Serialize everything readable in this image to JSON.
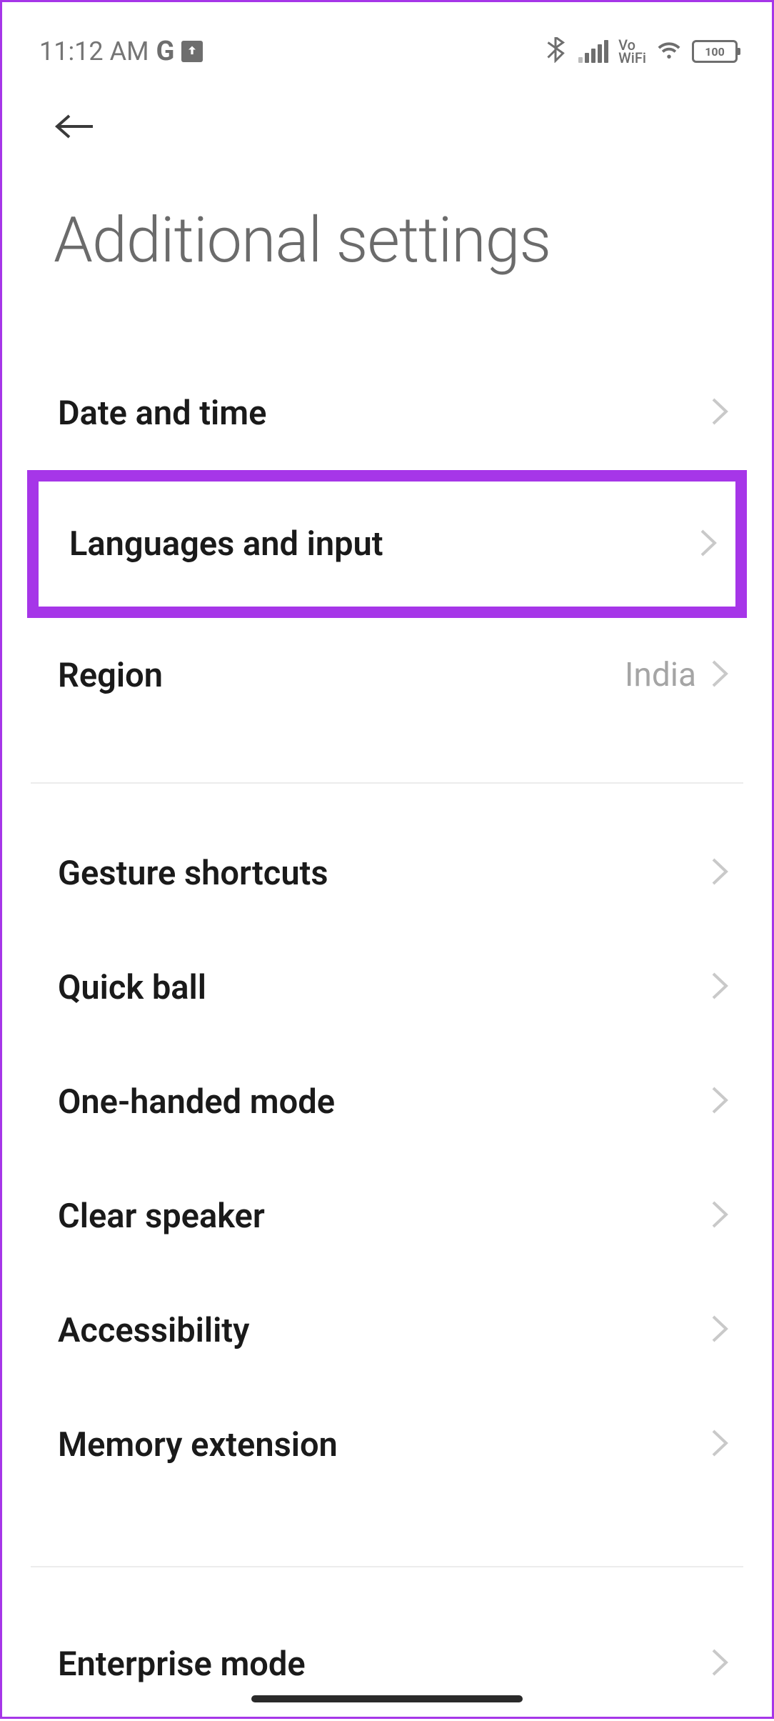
{
  "status_bar": {
    "time": "11:12 AM",
    "vowifi_top": "Vo",
    "vowifi_bottom": "WiFi",
    "battery": "100"
  },
  "page_title": "Additional settings",
  "items": {
    "date_time": "Date and time",
    "languages_input": "Languages and input",
    "region_label": "Region",
    "region_value": "India",
    "gesture_shortcuts": "Gesture shortcuts",
    "quick_ball": "Quick ball",
    "one_handed": "One-handed mode",
    "clear_speaker": "Clear speaker",
    "accessibility": "Accessibility",
    "memory_extension": "Memory extension",
    "enterprise_mode": "Enterprise mode"
  }
}
